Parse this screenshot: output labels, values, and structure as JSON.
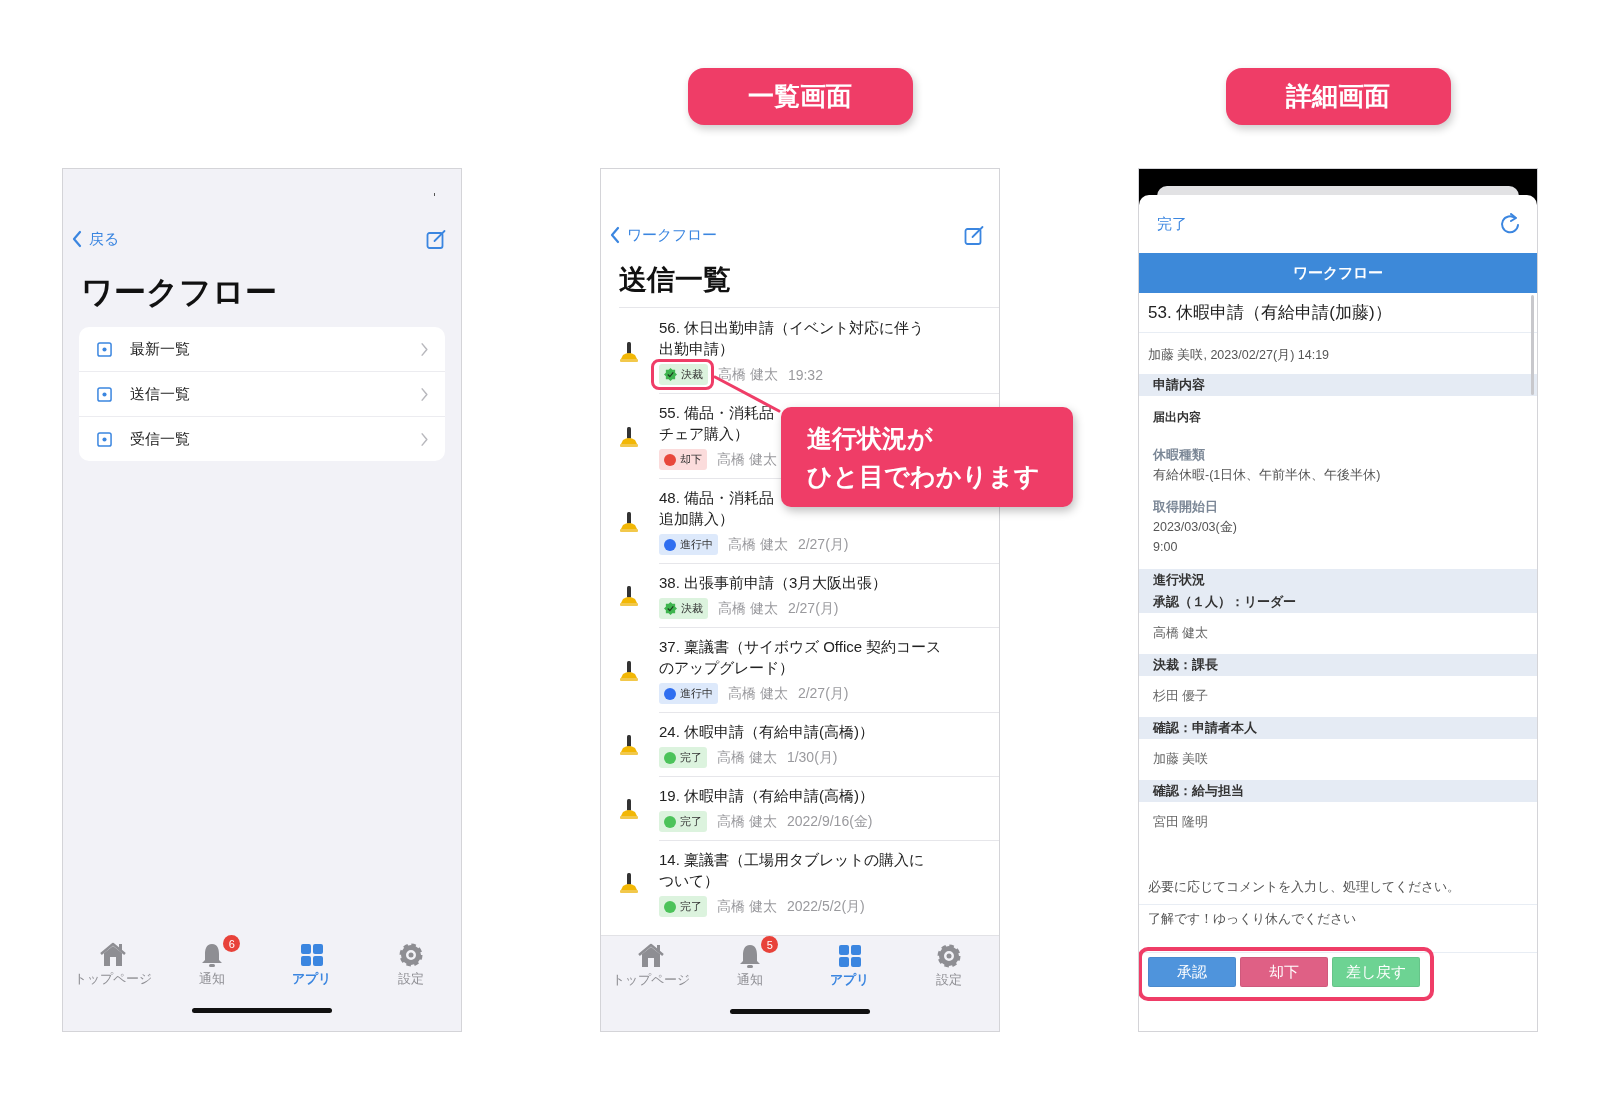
{
  "menu_screen": {
    "back": "戻る",
    "title": "ワークフロー",
    "items": [
      {
        "label": "最新一覧"
      },
      {
        "label": "送信一覧"
      },
      {
        "label": "受信一覧"
      }
    ],
    "tabs": [
      {
        "kind": "home",
        "label": "トップページ",
        "selected": false
      },
      {
        "kind": "bell",
        "label": "通知",
        "selected": false,
        "badge": "6"
      },
      {
        "kind": "apps",
        "label": "アプリ",
        "selected": true
      },
      {
        "kind": "gear",
        "label": "設定",
        "selected": false
      }
    ]
  },
  "list_screen": {
    "heading": "一覧画面",
    "back": "ワークフロー",
    "title": "送信一覧",
    "items": [
      {
        "title_lines": [
          "56. 休日出勤申請（イベント対応に伴う",
          "出勤申請）"
        ],
        "status": {
          "kind": "approved",
          "label": "決裁"
        },
        "author": "高橋 健太",
        "date": "19:32",
        "highlighted": true
      },
      {
        "title_lines": [
          "55. 備品・消耗品",
          "チェア購入）"
        ],
        "status": {
          "kind": "rejected",
          "label": "却下"
        },
        "author": "高橋 健太",
        "highlighted": false
      },
      {
        "title_lines": [
          "48. 備品・消耗品",
          "追加購入）"
        ],
        "status": {
          "kind": "in_progress",
          "label": "進行中"
        },
        "author": "高橋 健太",
        "date": "2/27(月)",
        "highlighted": false
      },
      {
        "title_lines": [
          "38. 出張事前申請（3月大阪出張）"
        ],
        "status": {
          "kind": "approved",
          "label": "決裁"
        },
        "author": "高橋 健太",
        "date": "2/27(月)",
        "highlighted": false
      },
      {
        "title_lines": [
          "37. 稟議書（サイボウズ Office 契約コース",
          "のアップグレード）"
        ],
        "status": {
          "kind": "in_progress",
          "label": "進行中"
        },
        "author": "高橋 健太",
        "date": "2/27(月)",
        "highlighted": false
      },
      {
        "title_lines": [
          "24. 休暇申請（有給申請(高橋)）"
        ],
        "status": {
          "kind": "done",
          "label": "完了"
        },
        "author": "高橋 健太",
        "date": "1/30(月)",
        "highlighted": false
      },
      {
        "title_lines": [
          "19. 休暇申請（有給申請(高橋)）"
        ],
        "status": {
          "kind": "done",
          "label": "完了"
        },
        "author": "高橋 健太",
        "date": "2022/9/16(金)",
        "highlighted": false
      },
      {
        "title_lines": [
          "14. 稟議書（工場用タブレットの購入に",
          "ついて）"
        ],
        "status": {
          "kind": "done",
          "label": "完了"
        },
        "author": "高橋 健太",
        "date": "2022/5/2(月)",
        "highlighted": false
      }
    ],
    "callout": {
      "lines": [
        "進行状況が",
        "ひと目でわかります"
      ]
    },
    "tabs": [
      {
        "kind": "home",
        "label": "トップページ",
        "selected": false
      },
      {
        "kind": "bell",
        "label": "通知",
        "selected": false,
        "badge": "5"
      },
      {
        "kind": "apps",
        "label": "アプリ",
        "selected": true
      },
      {
        "kind": "gear",
        "label": "設定",
        "selected": false
      }
    ]
  },
  "detail_screen": {
    "heading": "詳細画面",
    "done": "完了",
    "header": "ワークフロー",
    "title": "53. 休暇申請（有給申請(加藤)）",
    "meta": "加藤 美咲, 2023/02/27(月) 14:19",
    "rows": [
      {
        "kind": "section",
        "lines": [
          "申請内容"
        ]
      },
      {
        "kind": "subhead",
        "text": "届出内容"
      },
      {
        "kind": "field",
        "label": "休暇種類",
        "values": [
          "有給休暇-(1日休、午前半休、午後半休)"
        ]
      },
      {
        "kind": "field",
        "label": "取得開始日",
        "values": [
          "2023/03/03(金)",
          "9:00"
        ]
      },
      {
        "kind": "section",
        "lines": [
          "進行状況",
          "承認（１人）：リーダー"
        ]
      },
      {
        "kind": "person",
        "text": "高橋 健太"
      },
      {
        "kind": "section",
        "lines": [
          "決裁：課長"
        ]
      },
      {
        "kind": "person",
        "text": "杉田 優子"
      },
      {
        "kind": "section",
        "lines": [
          "確認：申請者本人"
        ]
      },
      {
        "kind": "person",
        "text": "加藤 美咲"
      },
      {
        "kind": "section",
        "lines": [
          "確認：給与担当"
        ]
      },
      {
        "kind": "person",
        "text": "宮田 隆明"
      }
    ],
    "prompt": "必要に応じてコメントを入力し、処理してください。",
    "comment": "了解です！ゆっくり休んでください",
    "buttons_highlighted": true,
    "buttons": [
      {
        "kind": "approve",
        "label": "承認"
      },
      {
        "kind": "reject",
        "label": "却下"
      },
      {
        "kind": "return",
        "label": "差し戻す"
      }
    ]
  }
}
